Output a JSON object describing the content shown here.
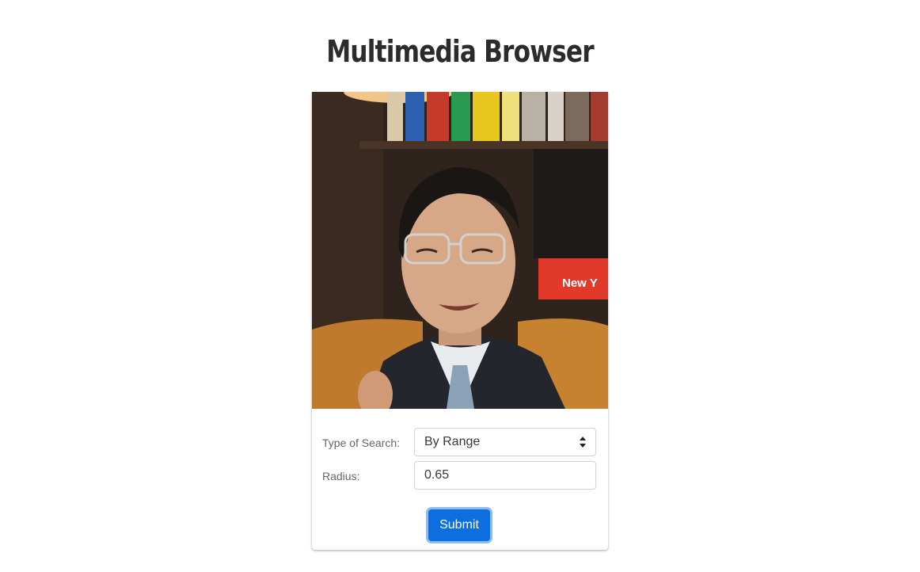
{
  "header": {
    "title": "Multimedia Browser"
  },
  "result": {
    "image_alt": "Search result photo",
    "book_spine_text": "New Y"
  },
  "form": {
    "search_type_label": "Type of Search:",
    "search_type_value": "By Range",
    "radius_label": "Radius:",
    "radius_value": "0.65",
    "submit_label": "Submit"
  },
  "colors": {
    "title": "#2b2b2b",
    "button": "#0d6ee0",
    "button_focus_ring": "#8fbcf2",
    "label": "#666666"
  },
  "icons": {
    "select_arrows": "updown-caret-icon"
  }
}
